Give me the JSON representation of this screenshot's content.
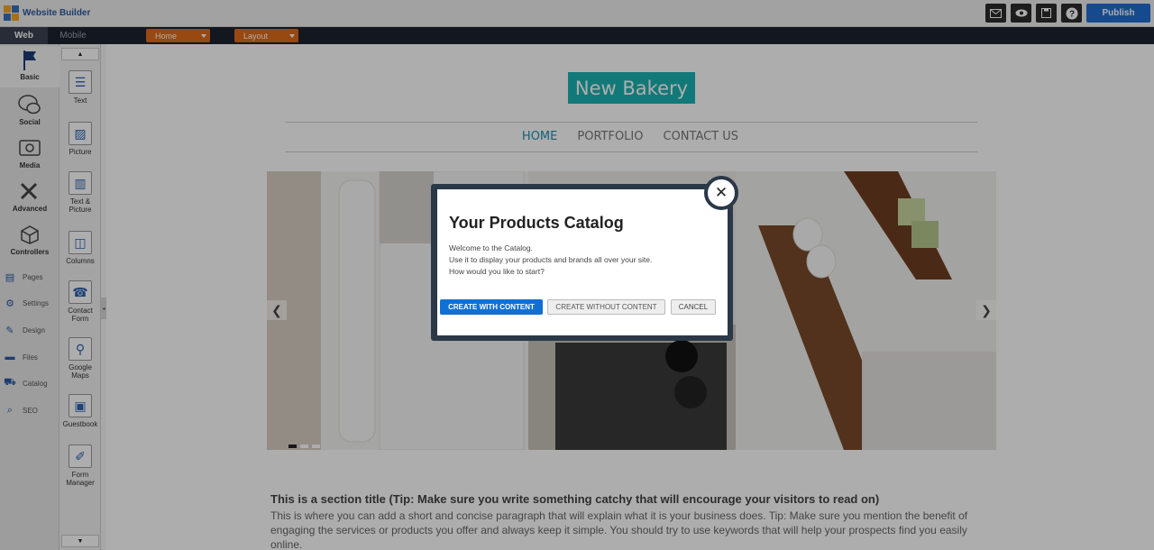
{
  "app": {
    "logo_text": "Website Builder"
  },
  "topbar": {
    "publish_label": "Publish",
    "icons": [
      "mail-icon",
      "eye-icon",
      "save-icon",
      "help-icon"
    ]
  },
  "tabs": {
    "web": "Web",
    "mobile": "Mobile"
  },
  "dropdowns": {
    "page": "Home",
    "layout": "Layout"
  },
  "sidebar": {
    "categories": [
      {
        "label": "Basic",
        "icon": "flag-icon"
      },
      {
        "label": "Social",
        "icon": "chat-icon"
      },
      {
        "label": "Media",
        "icon": "media-icon"
      },
      {
        "label": "Advanced",
        "icon": "tools-icon"
      },
      {
        "label": "Controllers",
        "icon": "box-icon"
      }
    ],
    "links": [
      {
        "label": "Pages",
        "icon": "pages-icon"
      },
      {
        "label": "Settings",
        "icon": "settings-icon"
      },
      {
        "label": "Design",
        "icon": "design-icon"
      },
      {
        "label": "Files",
        "icon": "folder-icon"
      },
      {
        "label": "Catalog",
        "icon": "cart-icon"
      },
      {
        "label": "SEO",
        "icon": "search-icon"
      }
    ]
  },
  "widgets": [
    {
      "label": "Text",
      "icon": "text-icon"
    },
    {
      "label": "Picture",
      "icon": "picture-icon"
    },
    {
      "label": "Text & Picture",
      "icon": "text-picture-icon"
    },
    {
      "label": "Columns",
      "icon": "columns-icon"
    },
    {
      "label": "Contact Form",
      "icon": "phone-icon"
    },
    {
      "label": "Google Maps",
      "icon": "map-pin-icon"
    },
    {
      "label": "Guestbook",
      "icon": "guestbook-icon"
    },
    {
      "label": "Form Manager",
      "icon": "form-icon"
    }
  ],
  "site": {
    "title": "New Bakery",
    "nav": [
      "HOME",
      "PORTFOLIO",
      "CONTACT US"
    ],
    "section_title": "This is a section title (Tip: Make sure you write something catchy that will encourage your visitors to read on)",
    "section_body": "This is where you can add a short and concise paragraph that will explain what it is your business does. Tip: Make sure you mention the benefit of engaging the services or products you offer and always keep it simple. You should try to use keywords that will help your prospects find you easily online."
  },
  "modal": {
    "title": "Your Products Catalog",
    "line1": "Welcome to the Catalog.",
    "line2": "Use it to display your products and brands all over your site.",
    "line3": "How would you like to start?",
    "btn_primary": "CREATE WITH CONTENT",
    "btn_secondary": "CREATE WITHOUT CONTENT",
    "btn_cancel": "CANCEL"
  },
  "colors": {
    "accent": "#1170d3",
    "publish": "#1f6fd1",
    "dropdown": "#e06b1a",
    "site_title_bg": "#1bb3b3",
    "modal_frame": "#2a3848"
  }
}
